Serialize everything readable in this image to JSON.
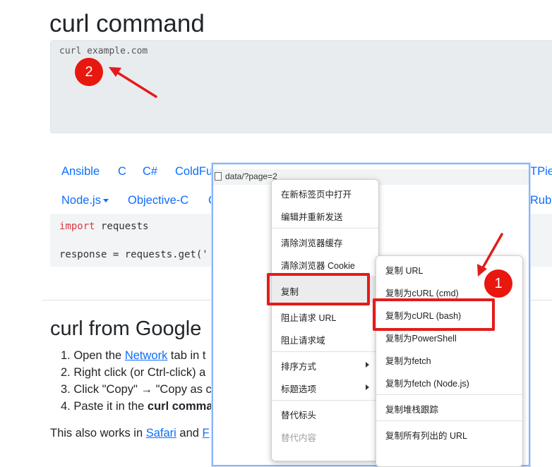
{
  "page": {
    "title": "curl command",
    "command": "curl example.com",
    "lang_row1": [
      "Ansible",
      "C",
      "C#",
      "ColdFu"
    ],
    "lang_row1_right": "TPie",
    "lang_row2": [
      "Node.js",
      "Objective-C",
      "C"
    ],
    "lang_row2_right": "Rub",
    "code_line1_kw": "import",
    "code_line1_rest": " requests",
    "code_line2": "response = requests.get('",
    "section_title": "curl from Google",
    "steps": [
      {
        "num": "1. Open the ",
        "link": "Network",
        "rest": " tab in t"
      },
      {
        "num": "2. Right click (or Ctrl-click) a",
        "link": "",
        "rest": ""
      },
      {
        "num": "3. Click \"Copy\" → \"Copy as c",
        "link": "",
        "rest": ""
      },
      {
        "num": "4. Paste it in the ",
        "bold": "curl comma",
        "rest": ""
      }
    ],
    "para_pre": "This also works in ",
    "para_link1": "Safari",
    "para_mid": " and ",
    "para_link2": "F"
  },
  "devtools": {
    "url": "data/?page=2"
  },
  "main_menu": {
    "items": [
      "在新标签页中打开",
      "编辑并重新发送",
      "清除浏览器缓存",
      "清除浏览器 Cookie",
      "复制",
      "阻止请求 URL",
      "阻止请求域",
      "排序方式",
      "标题选项",
      "替代标头",
      "替代内容"
    ]
  },
  "copy_submenu": {
    "items": [
      "复制 URL",
      "复制为cURL (cmd)",
      "复制为cURL (bash)",
      "复制为PowerShell",
      "复制为fetch",
      "复制为fetch (Node.js)",
      "复制堆栈跟踪",
      "复制所有列出的 URL"
    ]
  },
  "annotations": {
    "badge1": "1",
    "badge2": "2",
    "color": "#e41b1b"
  }
}
